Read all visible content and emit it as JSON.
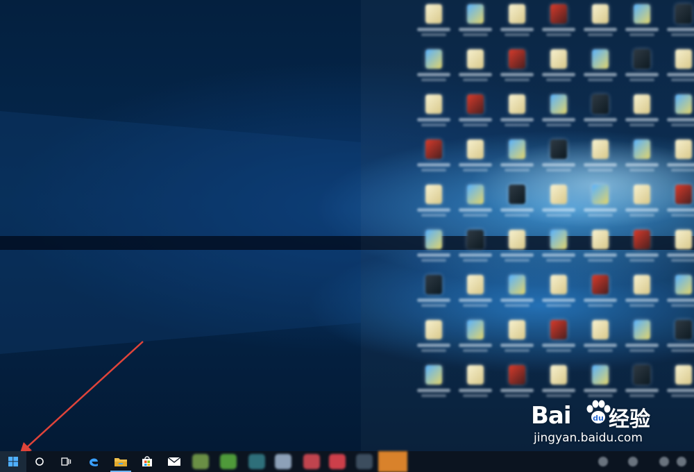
{
  "watermark": {
    "brand": "Bai",
    "brand_suffix": "经验",
    "url": "jingyan.baidu.com"
  },
  "annotation": {
    "arrow_color": "#e0443a",
    "points_to": "start-button"
  },
  "taskbar": {
    "start_icon": "windows-logo-icon",
    "search_icon": "cortana-circle-icon",
    "taskview_icon": "task-view-icon",
    "pinned": [
      "edge-icon",
      "file-explorer-icon",
      "store-icon",
      "mail-icon"
    ],
    "accent": "#6fb6ff"
  },
  "desktop": {
    "icons_blurred": true,
    "wallpaper": "windows-10-hero"
  }
}
